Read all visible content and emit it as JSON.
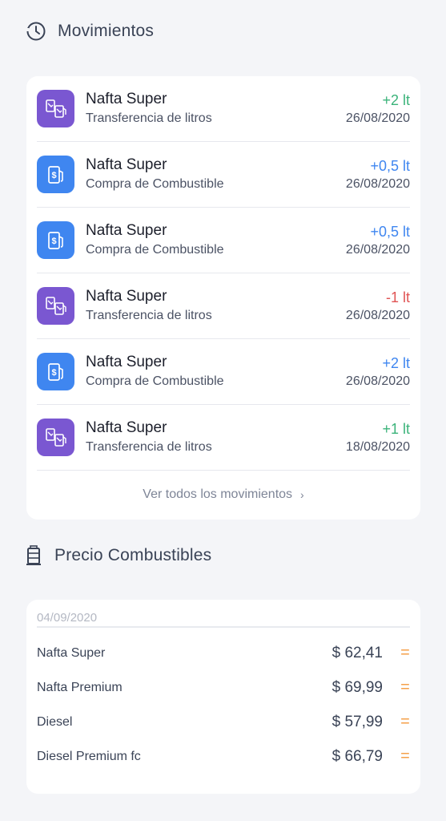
{
  "movimientos": {
    "title": "Movimientos",
    "items": [
      {
        "title": "Nafta Super",
        "subtitle": "Transferencia de litros",
        "amount": "+2 lt",
        "date": "26/08/2020",
        "type": "transfer",
        "color": "#3bb37a"
      },
      {
        "title": "Nafta Super",
        "subtitle": "Compra de Combustible",
        "amount": "+0,5 lt",
        "date": "26/08/2020",
        "type": "purchase",
        "color": "#3f86f0"
      },
      {
        "title": "Nafta Super",
        "subtitle": "Compra de Combustible",
        "amount": "+0,5 lt",
        "date": "26/08/2020",
        "type": "purchase",
        "color": "#3f86f0"
      },
      {
        "title": "Nafta Super",
        "subtitle": "Transferencia de litros",
        "amount": "-1 lt",
        "date": "26/08/2020",
        "type": "transfer",
        "color": "#e05454"
      },
      {
        "title": "Nafta Super",
        "subtitle": "Compra de Combustible",
        "amount": "+2 lt",
        "date": "26/08/2020",
        "type": "purchase",
        "color": "#3f86f0"
      },
      {
        "title": "Nafta Super",
        "subtitle": "Transferencia de litros",
        "amount": "+1 lt",
        "date": "18/08/2020",
        "type": "transfer",
        "color": "#3bb37a"
      }
    ],
    "ver_todos": "Ver todos los movimientos",
    "ver_todos_chevron": "›"
  },
  "precio": {
    "title": "Precio Combustibles",
    "date": "04/09/2020",
    "rows": [
      {
        "name": "Nafta Super",
        "value": "$ 62,41",
        "trend": "="
      },
      {
        "name": "Nafta Premium",
        "value": "$ 69,99",
        "trend": "="
      },
      {
        "name": "Diesel",
        "value": "$ 57,99",
        "trend": "="
      },
      {
        "name": "Diesel Premium fc",
        "value": "$ 66,79",
        "trend": "="
      }
    ]
  },
  "colors": {
    "transfer_icon_bg": "#7a57d1",
    "purchase_icon_bg": "#3f86f0",
    "trend_equal": "#f5a04a"
  },
  "icons": {
    "movimientos": "clock-history-icon",
    "precio": "fuel-pump-icon",
    "transfer": "fuel-transfer-icon",
    "purchase": "fuel-purchase-icon"
  }
}
